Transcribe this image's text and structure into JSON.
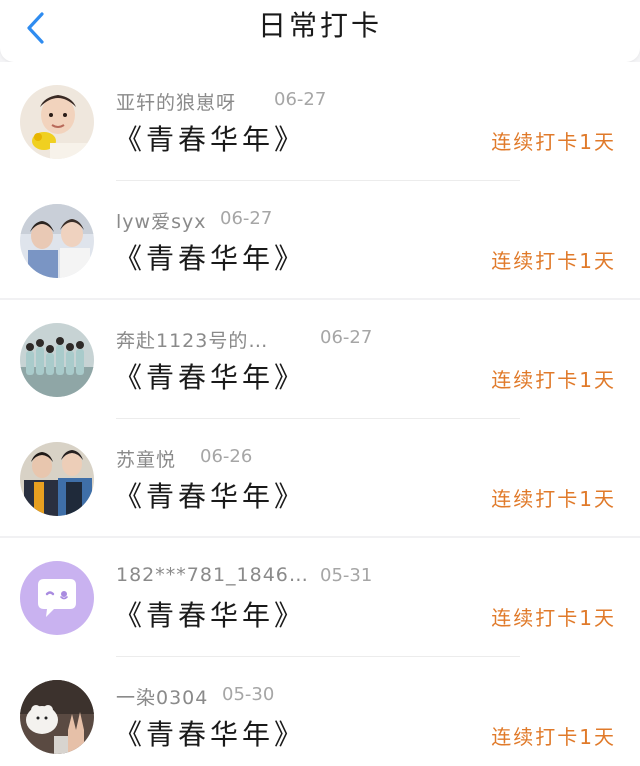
{
  "header": {
    "title": "日常打卡",
    "back_icon": "chevron-left-icon",
    "accent": "#2f8cf0"
  },
  "colors": {
    "streak": "#e07a2a",
    "name": "#8a8a8a",
    "book": "#1a1a1a"
  },
  "entries": [
    {
      "name": "亚轩的狼崽呀",
      "date": "06-27",
      "book": "《青春华年》",
      "streak": "连续打卡1天",
      "avatar": "photo-avatar"
    },
    {
      "name": "lyw爱syx",
      "date": "06-27",
      "book": "《青春华年》",
      "streak": "连续打卡1天",
      "avatar": "photo-avatar"
    },
    {
      "name": "奔赴1123号的…",
      "date": "06-27",
      "book": "《青春华年》",
      "streak": "连续打卡1天",
      "avatar": "photo-avatar"
    },
    {
      "name": "苏童悦",
      "date": "06-26",
      "book": "《青春华年》",
      "streak": "连续打卡1天",
      "avatar": "photo-avatar"
    },
    {
      "name": "182***781_1846…",
      "date": "05-31",
      "book": "《青春华年》",
      "streak": "连续打卡1天",
      "avatar": "default-chat-avatar-icon"
    },
    {
      "name": "一染0304",
      "date": "05-30",
      "book": "《青春华年》",
      "streak": "连续打卡1天",
      "avatar": "photo-avatar"
    }
  ]
}
